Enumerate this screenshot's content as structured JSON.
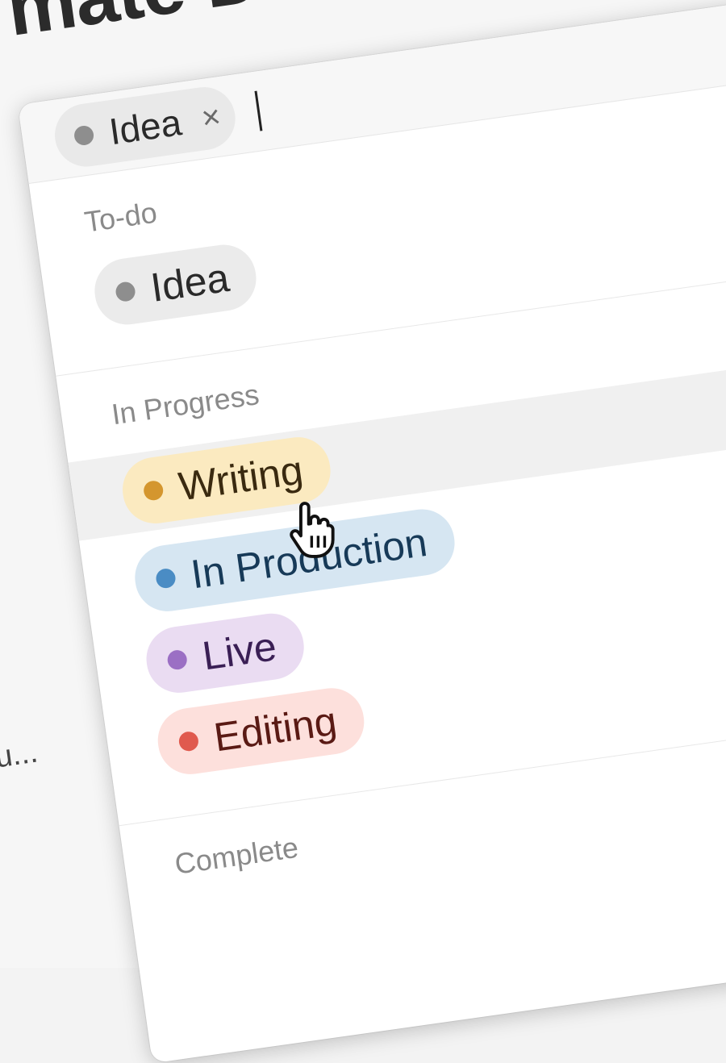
{
  "page": {
    "title": "mate D",
    "side_snippet": "u..."
  },
  "selector": {
    "selected_chip": {
      "label": "Idea",
      "color": "#8e8e8e",
      "remove_glyph": "×"
    }
  },
  "groups": [
    {
      "label": "To-do",
      "options": [
        {
          "label": "Idea",
          "dot": "#8e8e8e",
          "bg": "#ebebeb",
          "text": "#2a2a2a"
        }
      ]
    },
    {
      "label": "In Progress",
      "options": [
        {
          "label": "Writing",
          "dot": "#d4962e",
          "bg": "#fbeac0",
          "text": "#3a2a10",
          "hovered": true
        },
        {
          "label": "In Production",
          "dot": "#4a8cc4",
          "bg": "#d6e6f2",
          "text": "#173a58"
        },
        {
          "label": "Live",
          "dot": "#9b6fc4",
          "bg": "#eadcf2",
          "text": "#3a1f55"
        },
        {
          "label": "Editing",
          "dot": "#e05a4e",
          "bg": "#fde0dc",
          "text": "#5a1a14"
        }
      ]
    },
    {
      "label": "Complete",
      "options": []
    }
  ],
  "icons": {
    "cursor": "hand-pointer-icon",
    "remove": "close-icon"
  }
}
